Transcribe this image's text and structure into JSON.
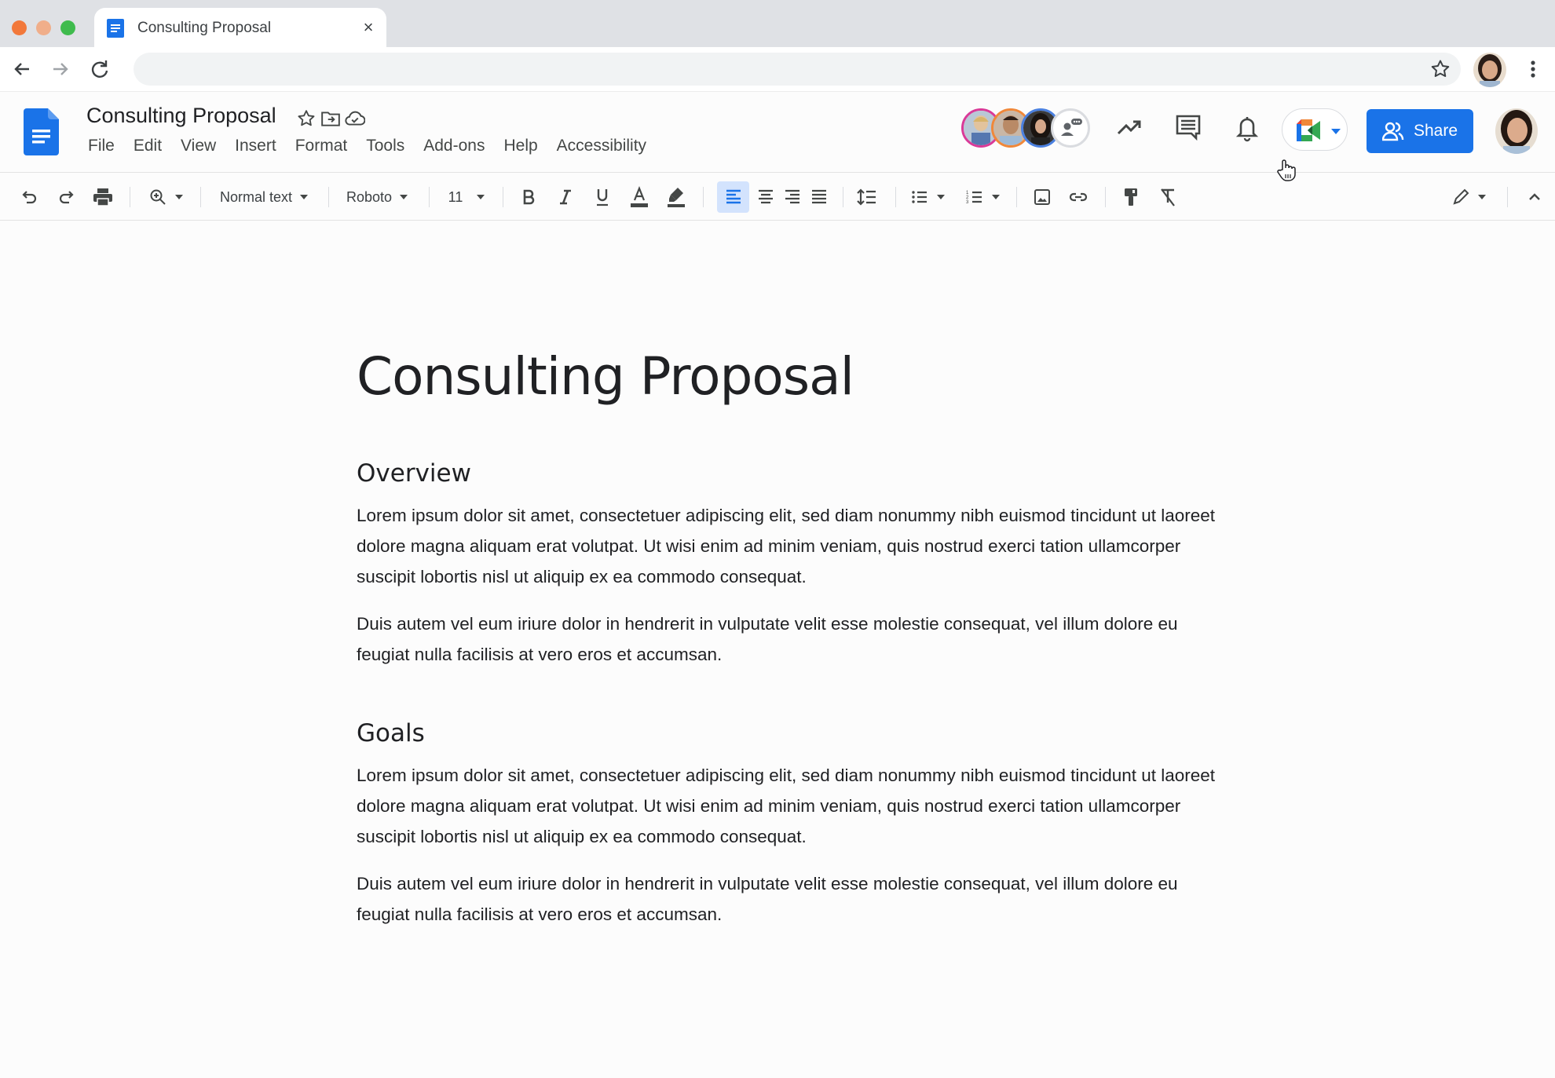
{
  "browser": {
    "tab": {
      "title": "Consulting Proposal",
      "close_label": "×"
    },
    "address": {
      "value": "",
      "placeholder": ""
    },
    "traffic_lights": {
      "close": "#f2783a",
      "minimize": "#f0ae8a",
      "maximize": "#3fbb4d"
    },
    "icons": [
      "back-icon",
      "forward-icon",
      "reload-icon",
      "bookmark-star-icon",
      "profile-avatar",
      "more-vert-icon"
    ]
  },
  "docs_header": {
    "title": "Consulting Proposal",
    "title_icons": [
      "star-icon",
      "move-to-folder-icon",
      "cloud-saved-icon"
    ],
    "menu": [
      "File",
      "Edit",
      "View",
      "Insert",
      "Format",
      "Tools",
      "Add-ons",
      "Help",
      "Accessibility"
    ],
    "collaborators": [
      {
        "name": "collaborator-1",
        "ring": "#d93a98"
      },
      {
        "name": "collaborator-2",
        "ring": "#f0883a"
      },
      {
        "name": "collaborator-3",
        "ring": "#4a80e0"
      }
    ],
    "share_label": "Share",
    "colors": {
      "brand": "#1a73e8",
      "accent_selected": "#d3e3fd"
    }
  },
  "toolbar": {
    "style": "Normal text",
    "font": "Roboto",
    "size": "11",
    "alignment_selected": "left"
  },
  "document": {
    "title": "Consulting Proposal",
    "sections": [
      {
        "heading": "Overview",
        "paragraphs": [
          "Lorem ipsum dolor sit amet, consectetuer adipiscing elit, sed diam nonummy nibh euismod tincidunt ut laoreet dolore magna aliquam erat volutpat. Ut wisi enim ad minim veniam, quis nostrud exerci tation ullamcorper suscipit lobortis nisl ut aliquip ex ea commodo consequat.",
          "Duis autem vel eum iriure dolor in hendrerit in vulputate velit esse molestie consequat, vel illum dolore eu feugiat nulla facilisis at vero eros et accumsan."
        ]
      },
      {
        "heading": "Goals",
        "paragraphs": [
          "Lorem ipsum dolor sit amet, consectetuer adipiscing elit, sed diam nonummy nibh euismod tincidunt ut laoreet dolore magna aliquam erat volutpat. Ut wisi enim ad minim veniam, quis nostrud exerci tation ullamcorper suscipit lobortis nisl ut aliquip ex ea commodo consequat.",
          "Duis autem vel eum iriure dolor in hendrerit in vulputate velit esse molestie consequat, vel illum dolore eu feugiat nulla facilisis at vero eros et accumsan."
        ]
      }
    ]
  }
}
